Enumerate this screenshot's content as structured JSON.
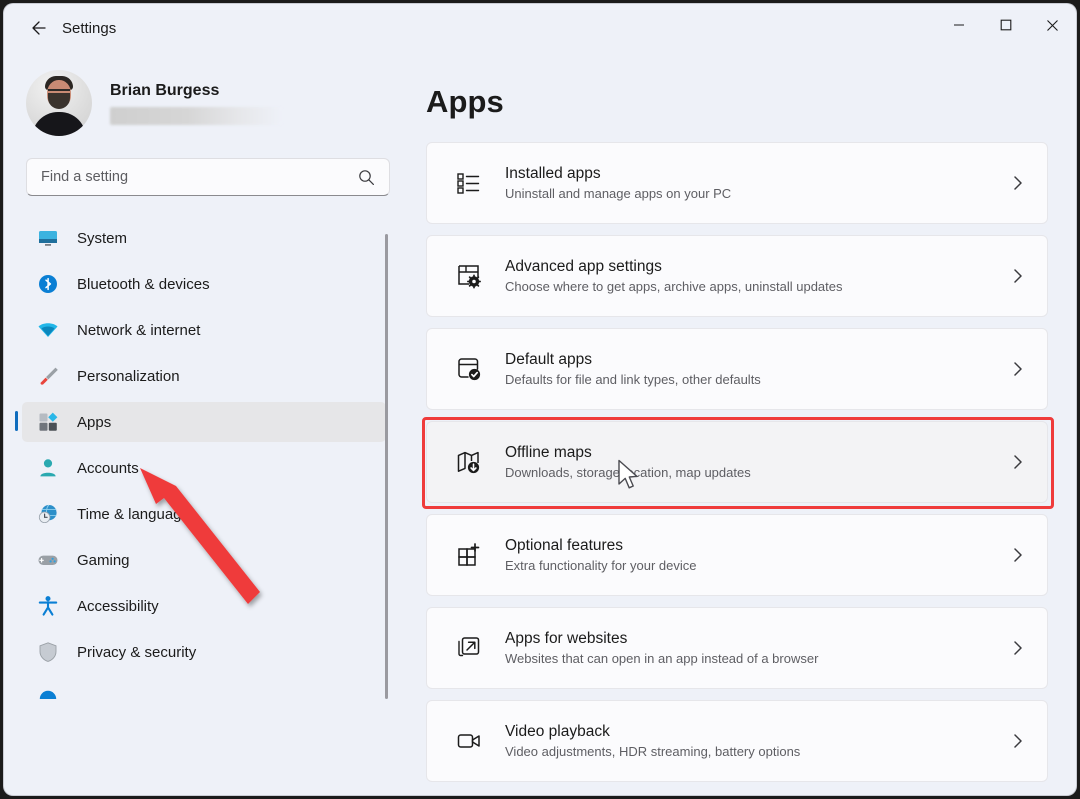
{
  "window": {
    "title": "Settings",
    "back_icon": "back-arrow-icon",
    "controls": {
      "minimize": "minimize-icon",
      "maximize": "maximize-icon",
      "close": "close-icon"
    }
  },
  "profile": {
    "name": "Brian Burgess",
    "email_redacted": "",
    "avatar": "user-avatar"
  },
  "search": {
    "placeholder": "Find a setting",
    "value": "",
    "icon": "search-icon"
  },
  "sidebar": {
    "items": [
      {
        "label": "System",
        "icon": "monitor-icon",
        "selected": false
      },
      {
        "label": "Bluetooth & devices",
        "icon": "bluetooth-icon",
        "selected": false
      },
      {
        "label": "Network & internet",
        "icon": "wifi-icon",
        "selected": false
      },
      {
        "label": "Personalization",
        "icon": "paintbrush-icon",
        "selected": false
      },
      {
        "label": "Apps",
        "icon": "apps-grid-icon",
        "selected": true
      },
      {
        "label": "Accounts",
        "icon": "person-icon",
        "selected": false
      },
      {
        "label": "Time & language",
        "icon": "clock-globe-icon",
        "selected": false
      },
      {
        "label": "Gaming",
        "icon": "gamepad-icon",
        "selected": false
      },
      {
        "label": "Accessibility",
        "icon": "accessibility-icon",
        "selected": false
      },
      {
        "label": "Privacy & security",
        "icon": "shield-icon",
        "selected": false
      }
    ]
  },
  "main": {
    "page_title": "Apps",
    "cards": [
      {
        "title": "Installed apps",
        "subtitle": "Uninstall and manage apps on your PC",
        "icon": "list-apps-icon",
        "highlighted": false
      },
      {
        "title": "Advanced app settings",
        "subtitle": "Choose where to get apps, archive apps, uninstall updates",
        "icon": "window-gear-icon",
        "highlighted": false
      },
      {
        "title": "Default apps",
        "subtitle": "Defaults for file and link types, other defaults",
        "icon": "window-check-icon",
        "highlighted": false
      },
      {
        "title": "Offline maps",
        "subtitle": "Downloads, storage location, map updates",
        "icon": "map-download-icon",
        "highlighted": true
      },
      {
        "title": "Optional features",
        "subtitle": "Extra functionality for your device",
        "icon": "grid-plus-icon",
        "highlighted": false
      },
      {
        "title": "Apps for websites",
        "subtitle": "Websites that can open in an app instead of a browser",
        "icon": "external-window-icon",
        "highlighted": false
      },
      {
        "title": "Video playback",
        "subtitle": "Video adjustments, HDR streaming, battery options",
        "icon": "video-camera-icon",
        "highlighted": false
      }
    ],
    "chevron_icon": "chevron-right-icon"
  },
  "annotations": {
    "arrow_color": "#ef3b3b",
    "highlight_color": "#ef3b3b",
    "cursor": "mouse-pointer"
  },
  "colors": {
    "accent": "#0f6cbd",
    "window_bg": "#eef1f8",
    "card_bg": "#fbfbfd",
    "annotation_red": "#ef3b3b"
  }
}
